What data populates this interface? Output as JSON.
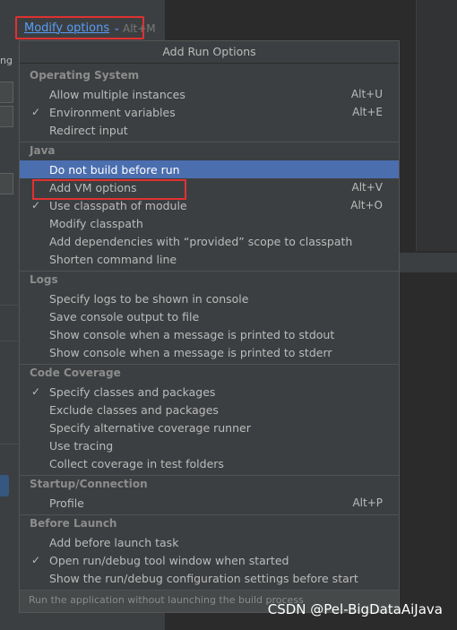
{
  "modify_options": {
    "label": "Modify options",
    "shortcut": "Alt+M"
  },
  "left_panel": {
    "partial_text": "ng"
  },
  "popup": {
    "title": "Add Run Options",
    "footer": "Run the application without launching the build process",
    "sections": [
      {
        "header": "Operating System",
        "items": [
          {
            "label": "Allow multiple instances",
            "shortcut": "Alt+U",
            "checked": false
          },
          {
            "label": "Environment variables",
            "shortcut": "Alt+E",
            "checked": true
          },
          {
            "label": "Redirect input",
            "shortcut": "",
            "checked": false
          }
        ]
      },
      {
        "header": "Java",
        "items": [
          {
            "label": "Do not build before run",
            "shortcut": "",
            "checked": false,
            "selected": true
          },
          {
            "label": "Add VM options",
            "shortcut": "Alt+V",
            "checked": false
          },
          {
            "label": "Use classpath of module",
            "shortcut": "Alt+O",
            "checked": true
          },
          {
            "label": "Modify classpath",
            "shortcut": "",
            "checked": false
          },
          {
            "label": "Add dependencies with “provided” scope to classpath",
            "shortcut": "",
            "checked": false
          },
          {
            "label": "Shorten command line",
            "shortcut": "",
            "checked": false
          }
        ]
      },
      {
        "header": "Logs",
        "items": [
          {
            "label": "Specify logs to be shown in console",
            "shortcut": "",
            "checked": false
          },
          {
            "label": "Save console output to file",
            "shortcut": "",
            "checked": false
          },
          {
            "label": "Show console when a message is printed to stdout",
            "shortcut": "",
            "checked": false
          },
          {
            "label": "Show console when a message is printed to stderr",
            "shortcut": "",
            "checked": false
          }
        ]
      },
      {
        "header": "Code Coverage",
        "items": [
          {
            "label": "Specify classes and packages",
            "shortcut": "",
            "checked": true
          },
          {
            "label": "Exclude classes and packages",
            "shortcut": "",
            "checked": false
          },
          {
            "label": "Specify alternative coverage runner",
            "shortcut": "",
            "checked": false
          },
          {
            "label": "Use tracing",
            "shortcut": "",
            "checked": false
          },
          {
            "label": "Collect coverage in test folders",
            "shortcut": "",
            "checked": false
          }
        ]
      },
      {
        "header": "Startup/Connection",
        "items": [
          {
            "label": "Profile",
            "shortcut": "Alt+P",
            "checked": false
          }
        ]
      },
      {
        "header": "Before Launch",
        "items": [
          {
            "label": "Add before launch task",
            "shortcut": "",
            "checked": false
          },
          {
            "label": "Open run/debug tool window when started",
            "shortcut": "",
            "checked": true
          },
          {
            "label": "Show the run/debug configuration settings before start",
            "shortcut": "",
            "checked": false
          }
        ]
      }
    ]
  },
  "watermark": "CSDN @Pel-BigDataAiJava",
  "colors": {
    "accent": "#589df6",
    "selection": "#4b6eaf",
    "highlight_border": "#e03131",
    "popup_bg": "#3c3f41"
  },
  "icons": {
    "check": "check-icon",
    "chevron": "chevron-down-icon"
  }
}
